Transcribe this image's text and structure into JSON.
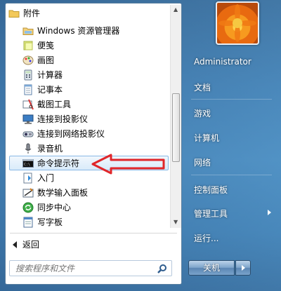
{
  "programs": [
    {
      "label": "附件",
      "icon": "folder-icon"
    },
    {
      "label": "Windows 资源管理器",
      "icon": "explorer-icon"
    },
    {
      "label": "便笺",
      "icon": "sticky-note-icon"
    },
    {
      "label": "画图",
      "icon": "paint-icon"
    },
    {
      "label": "计算器",
      "icon": "calculator-icon"
    },
    {
      "label": "记事本",
      "icon": "notepad-icon"
    },
    {
      "label": "截图工具",
      "icon": "snipping-tool-icon"
    },
    {
      "label": "连接到投影仪",
      "icon": "projector-icon"
    },
    {
      "label": "连接到网络投影仪",
      "icon": "network-projector-icon"
    },
    {
      "label": "录音机",
      "icon": "microphone-icon"
    },
    {
      "label": "命令提示符",
      "icon": "cmd-icon"
    },
    {
      "label": "入门",
      "icon": "getting-started-icon"
    },
    {
      "label": "数学输入面板",
      "icon": "math-input-icon"
    },
    {
      "label": "同步中心",
      "icon": "sync-icon"
    },
    {
      "label": "写字板",
      "icon": "wordpad-icon"
    }
  ],
  "selected_program": "命令提示符",
  "back_label": "返回",
  "search_placeholder": "搜索程序和文件",
  "right": {
    "username": "Administrator",
    "items": [
      "文档",
      "游戏",
      "计算机",
      "网络",
      "控制面板",
      "管理工具",
      "运行..."
    ]
  },
  "shutdown_label": "关机",
  "colors": {
    "annotation_arrow": "#e0262a",
    "selection_border": "#89b9e6"
  }
}
